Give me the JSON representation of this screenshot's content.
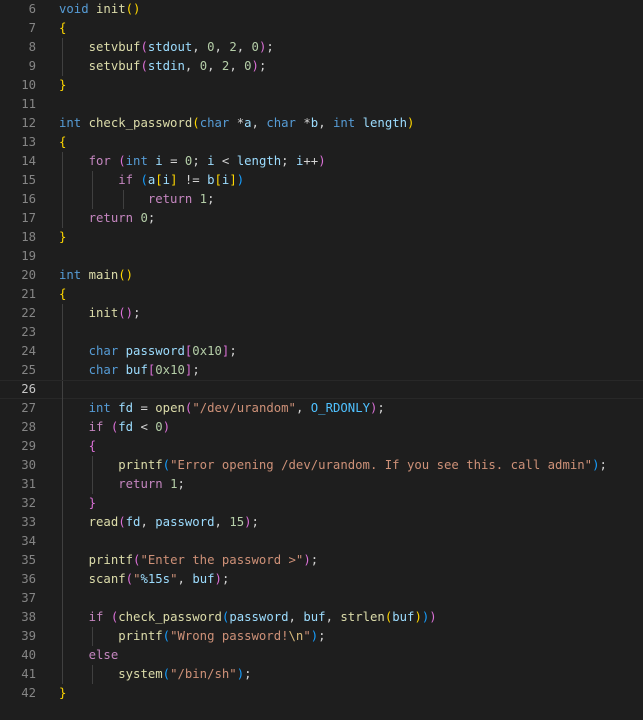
{
  "editor": {
    "language": "c",
    "theme_colors": {
      "background": "#1e1e1e",
      "line_number": "#858585",
      "active_line_number": "#c6c6c6",
      "keyword": "#569cd6",
      "control": "#c586c0",
      "function": "#dcdcaa",
      "variable": "#9cdcfe",
      "number": "#b5cea8",
      "string": "#ce9178",
      "constant": "#4fc1ff",
      "bracket_level_1": "#ffd700",
      "bracket_level_2": "#da70d6",
      "bracket_level_3": "#179fff"
    },
    "active_line": 26,
    "lines": [
      {
        "number": "6",
        "indent": 0,
        "tokens": [
          {
            "t": "void",
            "c": "kw"
          },
          {
            "t": " ",
            "c": "pl"
          },
          {
            "t": "init",
            "c": "fn"
          },
          {
            "t": "()",
            "c": "b1"
          }
        ]
      },
      {
        "number": "7",
        "indent": 0,
        "tokens": [
          {
            "t": "{",
            "c": "b1"
          }
        ]
      },
      {
        "number": "8",
        "indent": 1,
        "tokens": [
          {
            "t": "    ",
            "c": "pl"
          },
          {
            "t": "setvbuf",
            "c": "fn"
          },
          {
            "t": "(",
            "c": "b2"
          },
          {
            "t": "stdout",
            "c": "var"
          },
          {
            "t": ", ",
            "c": "pl"
          },
          {
            "t": "0",
            "c": "num"
          },
          {
            "t": ", ",
            "c": "pl"
          },
          {
            "t": "2",
            "c": "num"
          },
          {
            "t": ", ",
            "c": "pl"
          },
          {
            "t": "0",
            "c": "num"
          },
          {
            "t": ")",
            "c": "b2"
          },
          {
            "t": ";",
            "c": "pl"
          }
        ]
      },
      {
        "number": "9",
        "indent": 1,
        "tokens": [
          {
            "t": "    ",
            "c": "pl"
          },
          {
            "t": "setvbuf",
            "c": "fn"
          },
          {
            "t": "(",
            "c": "b2"
          },
          {
            "t": "stdin",
            "c": "var"
          },
          {
            "t": ", ",
            "c": "pl"
          },
          {
            "t": "0",
            "c": "num"
          },
          {
            "t": ", ",
            "c": "pl"
          },
          {
            "t": "2",
            "c": "num"
          },
          {
            "t": ", ",
            "c": "pl"
          },
          {
            "t": "0",
            "c": "num"
          },
          {
            "t": ")",
            "c": "b2"
          },
          {
            "t": ";",
            "c": "pl"
          }
        ]
      },
      {
        "number": "10",
        "indent": 0,
        "tokens": [
          {
            "t": "}",
            "c": "b1"
          }
        ]
      },
      {
        "number": "11",
        "indent": 0,
        "tokens": []
      },
      {
        "number": "12",
        "indent": 0,
        "tokens": [
          {
            "t": "int",
            "c": "kw"
          },
          {
            "t": " ",
            "c": "pl"
          },
          {
            "t": "check_password",
            "c": "fn"
          },
          {
            "t": "(",
            "c": "b1"
          },
          {
            "t": "char",
            "c": "kw"
          },
          {
            "t": " *",
            "c": "pl"
          },
          {
            "t": "a",
            "c": "var"
          },
          {
            "t": ", ",
            "c": "pl"
          },
          {
            "t": "char",
            "c": "kw"
          },
          {
            "t": " *",
            "c": "pl"
          },
          {
            "t": "b",
            "c": "var"
          },
          {
            "t": ", ",
            "c": "pl"
          },
          {
            "t": "int",
            "c": "kw"
          },
          {
            "t": " ",
            "c": "pl"
          },
          {
            "t": "length",
            "c": "var"
          },
          {
            "t": ")",
            "c": "b1"
          }
        ]
      },
      {
        "number": "13",
        "indent": 0,
        "tokens": [
          {
            "t": "{",
            "c": "b1"
          }
        ]
      },
      {
        "number": "14",
        "indent": 1,
        "tokens": [
          {
            "t": "    ",
            "c": "pl"
          },
          {
            "t": "for",
            "c": "ctl"
          },
          {
            "t": " ",
            "c": "pl"
          },
          {
            "t": "(",
            "c": "b2"
          },
          {
            "t": "int",
            "c": "kw"
          },
          {
            "t": " ",
            "c": "pl"
          },
          {
            "t": "i",
            "c": "var"
          },
          {
            "t": " = ",
            "c": "pl"
          },
          {
            "t": "0",
            "c": "num"
          },
          {
            "t": "; ",
            "c": "pl"
          },
          {
            "t": "i",
            "c": "var"
          },
          {
            "t": " < ",
            "c": "pl"
          },
          {
            "t": "length",
            "c": "var"
          },
          {
            "t": "; ",
            "c": "pl"
          },
          {
            "t": "i",
            "c": "var"
          },
          {
            "t": "++",
            "c": "pl"
          },
          {
            "t": ")",
            "c": "b2"
          }
        ]
      },
      {
        "number": "15",
        "indent": 2,
        "tokens": [
          {
            "t": "        ",
            "c": "pl"
          },
          {
            "t": "if",
            "c": "ctl"
          },
          {
            "t": " ",
            "c": "pl"
          },
          {
            "t": "(",
            "c": "b3"
          },
          {
            "t": "a",
            "c": "var"
          },
          {
            "t": "[",
            "c": "b1"
          },
          {
            "t": "i",
            "c": "var"
          },
          {
            "t": "]",
            "c": "b1"
          },
          {
            "t": " != ",
            "c": "pl"
          },
          {
            "t": "b",
            "c": "var"
          },
          {
            "t": "[",
            "c": "b1"
          },
          {
            "t": "i",
            "c": "var"
          },
          {
            "t": "]",
            "c": "b1"
          },
          {
            "t": ")",
            "c": "b3"
          }
        ]
      },
      {
        "number": "16",
        "indent": 3,
        "tokens": [
          {
            "t": "            ",
            "c": "pl"
          },
          {
            "t": "return",
            "c": "ctl"
          },
          {
            "t": " ",
            "c": "pl"
          },
          {
            "t": "1",
            "c": "num"
          },
          {
            "t": ";",
            "c": "pl"
          }
        ]
      },
      {
        "number": "17",
        "indent": 1,
        "tokens": [
          {
            "t": "    ",
            "c": "pl"
          },
          {
            "t": "return",
            "c": "ctl"
          },
          {
            "t": " ",
            "c": "pl"
          },
          {
            "t": "0",
            "c": "num"
          },
          {
            "t": ";",
            "c": "pl"
          }
        ]
      },
      {
        "number": "18",
        "indent": 0,
        "tokens": [
          {
            "t": "}",
            "c": "b1"
          }
        ]
      },
      {
        "number": "19",
        "indent": 0,
        "tokens": []
      },
      {
        "number": "20",
        "indent": 0,
        "tokens": [
          {
            "t": "int",
            "c": "kw"
          },
          {
            "t": " ",
            "c": "pl"
          },
          {
            "t": "main",
            "c": "fn"
          },
          {
            "t": "()",
            "c": "b1"
          }
        ]
      },
      {
        "number": "21",
        "indent": 0,
        "tokens": [
          {
            "t": "{",
            "c": "b1"
          }
        ]
      },
      {
        "number": "22",
        "indent": 1,
        "tokens": [
          {
            "t": "    ",
            "c": "pl"
          },
          {
            "t": "init",
            "c": "fn"
          },
          {
            "t": "()",
            "c": "b2"
          },
          {
            "t": ";",
            "c": "pl"
          }
        ]
      },
      {
        "number": "23",
        "indent": 1,
        "tokens": []
      },
      {
        "number": "24",
        "indent": 1,
        "tokens": [
          {
            "t": "    ",
            "c": "pl"
          },
          {
            "t": "char",
            "c": "kw"
          },
          {
            "t": " ",
            "c": "pl"
          },
          {
            "t": "password",
            "c": "var"
          },
          {
            "t": "[",
            "c": "b2"
          },
          {
            "t": "0x10",
            "c": "num"
          },
          {
            "t": "]",
            "c": "b2"
          },
          {
            "t": ";",
            "c": "pl"
          }
        ]
      },
      {
        "number": "25",
        "indent": 1,
        "tokens": [
          {
            "t": "    ",
            "c": "pl"
          },
          {
            "t": "char",
            "c": "kw"
          },
          {
            "t": " ",
            "c": "pl"
          },
          {
            "t": "buf",
            "c": "var"
          },
          {
            "t": "[",
            "c": "b2"
          },
          {
            "t": "0x10",
            "c": "num"
          },
          {
            "t": "]",
            "c": "b2"
          },
          {
            "t": ";",
            "c": "pl"
          }
        ]
      },
      {
        "number": "26",
        "indent": 1,
        "tokens": []
      },
      {
        "number": "27",
        "indent": 1,
        "tokens": [
          {
            "t": "    ",
            "c": "pl"
          },
          {
            "t": "int",
            "c": "kw"
          },
          {
            "t": " ",
            "c": "pl"
          },
          {
            "t": "fd",
            "c": "var"
          },
          {
            "t": " = ",
            "c": "pl"
          },
          {
            "t": "open",
            "c": "fn"
          },
          {
            "t": "(",
            "c": "b2"
          },
          {
            "t": "\"/dev/urandom\"",
            "c": "str"
          },
          {
            "t": ", ",
            "c": "pl"
          },
          {
            "t": "O_RDONLY",
            "c": "con"
          },
          {
            "t": ")",
            "c": "b2"
          },
          {
            "t": ";",
            "c": "pl"
          }
        ]
      },
      {
        "number": "28",
        "indent": 1,
        "tokens": [
          {
            "t": "    ",
            "c": "pl"
          },
          {
            "t": "if",
            "c": "ctl"
          },
          {
            "t": " ",
            "c": "pl"
          },
          {
            "t": "(",
            "c": "b2"
          },
          {
            "t": "fd",
            "c": "var"
          },
          {
            "t": " < ",
            "c": "pl"
          },
          {
            "t": "0",
            "c": "num"
          },
          {
            "t": ")",
            "c": "b2"
          }
        ]
      },
      {
        "number": "29",
        "indent": 1,
        "tokens": [
          {
            "t": "    ",
            "c": "pl"
          },
          {
            "t": "{",
            "c": "b2"
          }
        ]
      },
      {
        "number": "30",
        "indent": 2,
        "tokens": [
          {
            "t": "        ",
            "c": "pl"
          },
          {
            "t": "printf",
            "c": "fn"
          },
          {
            "t": "(",
            "c": "b3"
          },
          {
            "t": "\"Error opening /dev/urandom. If you see this. call admin\"",
            "c": "str"
          },
          {
            "t": ")",
            "c": "b3"
          },
          {
            "t": ";",
            "c": "pl"
          }
        ]
      },
      {
        "number": "31",
        "indent": 2,
        "tokens": [
          {
            "t": "        ",
            "c": "pl"
          },
          {
            "t": "return",
            "c": "ctl"
          },
          {
            "t": " ",
            "c": "pl"
          },
          {
            "t": "1",
            "c": "num"
          },
          {
            "t": ";",
            "c": "pl"
          }
        ]
      },
      {
        "number": "32",
        "indent": 1,
        "tokens": [
          {
            "t": "    ",
            "c": "pl"
          },
          {
            "t": "}",
            "c": "b2"
          }
        ]
      },
      {
        "number": "33",
        "indent": 1,
        "tokens": [
          {
            "t": "    ",
            "c": "pl"
          },
          {
            "t": "read",
            "c": "fn"
          },
          {
            "t": "(",
            "c": "b2"
          },
          {
            "t": "fd",
            "c": "var"
          },
          {
            "t": ", ",
            "c": "pl"
          },
          {
            "t": "password",
            "c": "var"
          },
          {
            "t": ", ",
            "c": "pl"
          },
          {
            "t": "15",
            "c": "num"
          },
          {
            "t": ")",
            "c": "b2"
          },
          {
            "t": ";",
            "c": "pl"
          }
        ]
      },
      {
        "number": "34",
        "indent": 1,
        "tokens": []
      },
      {
        "number": "35",
        "indent": 1,
        "tokens": [
          {
            "t": "    ",
            "c": "pl"
          },
          {
            "t": "printf",
            "c": "fn"
          },
          {
            "t": "(",
            "c": "b2"
          },
          {
            "t": "\"Enter the password >\"",
            "c": "str"
          },
          {
            "t": ")",
            "c": "b2"
          },
          {
            "t": ";",
            "c": "pl"
          }
        ]
      },
      {
        "number": "36",
        "indent": 1,
        "tokens": [
          {
            "t": "    ",
            "c": "pl"
          },
          {
            "t": "scanf",
            "c": "fn"
          },
          {
            "t": "(",
            "c": "b2"
          },
          {
            "t": "\"",
            "c": "str"
          },
          {
            "t": "%15s",
            "c": "var"
          },
          {
            "t": "\"",
            "c": "str"
          },
          {
            "t": ", ",
            "c": "pl"
          },
          {
            "t": "buf",
            "c": "var"
          },
          {
            "t": ")",
            "c": "b2"
          },
          {
            "t": ";",
            "c": "pl"
          }
        ]
      },
      {
        "number": "37",
        "indent": 1,
        "tokens": []
      },
      {
        "number": "38",
        "indent": 1,
        "tokens": [
          {
            "t": "    ",
            "c": "pl"
          },
          {
            "t": "if",
            "c": "ctl"
          },
          {
            "t": " ",
            "c": "pl"
          },
          {
            "t": "(",
            "c": "b2"
          },
          {
            "t": "check_password",
            "c": "fn"
          },
          {
            "t": "(",
            "c": "b3"
          },
          {
            "t": "password",
            "c": "var"
          },
          {
            "t": ", ",
            "c": "pl"
          },
          {
            "t": "buf",
            "c": "var"
          },
          {
            "t": ", ",
            "c": "pl"
          },
          {
            "t": "strlen",
            "c": "fn"
          },
          {
            "t": "(",
            "c": "b1"
          },
          {
            "t": "buf",
            "c": "var"
          },
          {
            "t": ")",
            "c": "b1"
          },
          {
            "t": ")",
            "c": "b3"
          },
          {
            "t": ")",
            "c": "b2"
          }
        ]
      },
      {
        "number": "39",
        "indent": 2,
        "tokens": [
          {
            "t": "        ",
            "c": "pl"
          },
          {
            "t": "printf",
            "c": "fn"
          },
          {
            "t": "(",
            "c": "b3"
          },
          {
            "t": "\"Wrong password!",
            "c": "str"
          },
          {
            "t": "\\n",
            "c": "esc"
          },
          {
            "t": "\"",
            "c": "str"
          },
          {
            "t": ")",
            "c": "b3"
          },
          {
            "t": ";",
            "c": "pl"
          }
        ]
      },
      {
        "number": "40",
        "indent": 1,
        "tokens": [
          {
            "t": "    ",
            "c": "pl"
          },
          {
            "t": "else",
            "c": "ctl"
          }
        ]
      },
      {
        "number": "41",
        "indent": 2,
        "tokens": [
          {
            "t": "        ",
            "c": "pl"
          },
          {
            "t": "system",
            "c": "fn"
          },
          {
            "t": "(",
            "c": "b3"
          },
          {
            "t": "\"/bin/sh\"",
            "c": "str"
          },
          {
            "t": ")",
            "c": "b3"
          },
          {
            "t": ";",
            "c": "pl"
          }
        ]
      },
      {
        "number": "42",
        "indent": 0,
        "tokens": [
          {
            "t": "}",
            "c": "b1"
          }
        ]
      }
    ]
  }
}
